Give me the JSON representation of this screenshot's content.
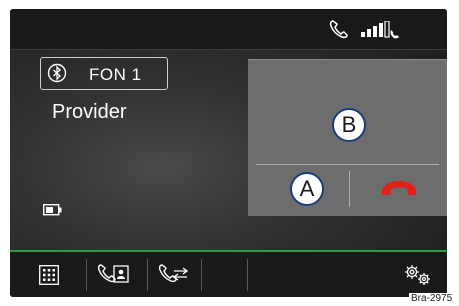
{
  "device": {
    "name": "FON 1",
    "provider": "Provider"
  },
  "call_panel": {
    "callout_b": "B",
    "callout_a": "A"
  },
  "icons": {
    "status_phone": "phone-handset-icon",
    "status_signal": "signal-strength-icon",
    "bluetooth": "bluetooth-icon",
    "battery": "battery-icon",
    "hangup": "hang-up-icon",
    "keypad": "keypad-icon",
    "contacts": "phonebook-icon",
    "call_list": "call-list-icon",
    "settings": "gears-icon"
  },
  "colors": {
    "accent_line": "#2d9d3a",
    "hangup": "#e0211a",
    "callout_border": "#1a3d78"
  },
  "reference": "Bra-2975"
}
